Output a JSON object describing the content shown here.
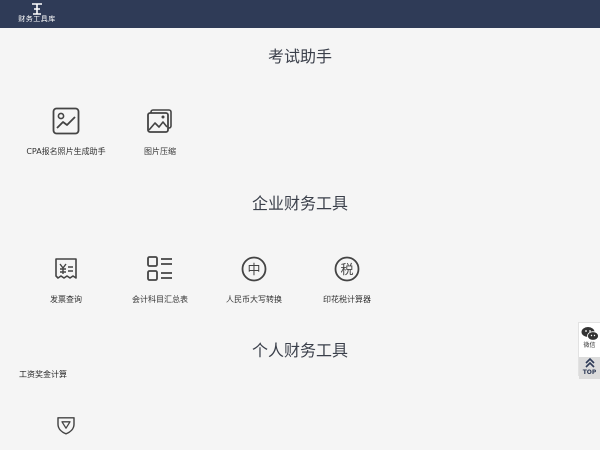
{
  "header": {
    "logo_text": "财务工具库"
  },
  "sections": [
    {
      "title": "考试助手",
      "tools": [
        {
          "label": "CPA报名照片生成助手",
          "icon": "image-chart-icon"
        },
        {
          "label": "图片压缩",
          "icon": "image-stack-icon"
        }
      ]
    },
    {
      "title": "企业财务工具",
      "tools": [
        {
          "label": "发票查询",
          "icon": "invoice-icon"
        },
        {
          "label": "会计科目汇总表",
          "icon": "list-summary-icon"
        },
        {
          "label": "人民币大写转换",
          "icon": "zhong-circle-icon",
          "glyph": "中"
        },
        {
          "label": "印花税计算器",
          "icon": "shui-circle-icon",
          "glyph": "税"
        }
      ]
    },
    {
      "title": "个人财务工具",
      "subheading": "工资奖金计算",
      "tools": [
        {
          "label": "",
          "icon": "shield-down-icon"
        }
      ]
    }
  ],
  "side": {
    "wechat_label": "微信",
    "top_label": "TOP"
  },
  "colors": {
    "header_bg": "#2f3b57",
    "page_bg": "#f5f5f5",
    "icon_stroke": "#444444"
  }
}
